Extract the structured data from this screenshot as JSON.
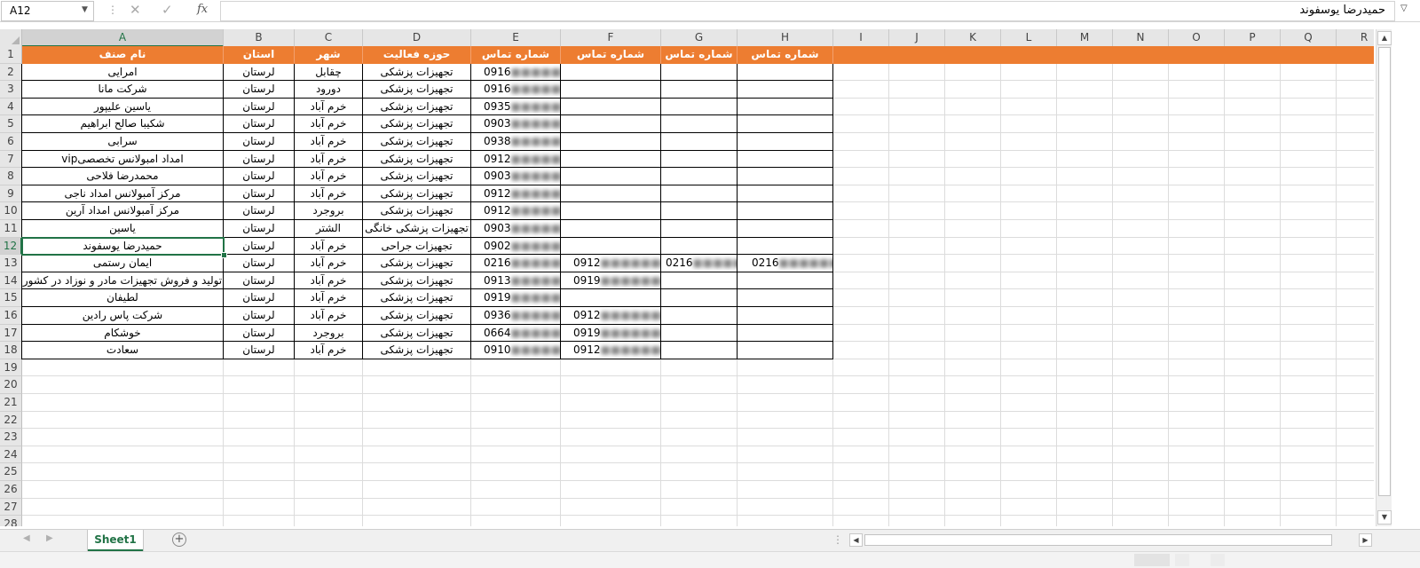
{
  "formula_bar": {
    "name_box": "A12",
    "fx_label": "fx",
    "formula_text": "حمیدرضا یوسفوند"
  },
  "columns": [
    "A",
    "B",
    "C",
    "D",
    "E",
    "F",
    "G",
    "H",
    "I",
    "J",
    "K",
    "L",
    "M",
    "N",
    "O",
    "P",
    "Q",
    "R"
  ],
  "rows": [
    "1",
    "2",
    "3",
    "4",
    "5",
    "6",
    "7",
    "8",
    "9",
    "10",
    "11",
    "12",
    "13",
    "14",
    "15",
    "16",
    "17",
    "18",
    "19",
    "20",
    "21",
    "22",
    "23",
    "24",
    "25",
    "26",
    "27",
    "28"
  ],
  "table": {
    "headers": [
      "نام صنف",
      "استان",
      "شهر",
      "حوزه فعالیت",
      "شماره تماس",
      "شماره تماس",
      "شماره تماس",
      "شماره تماس"
    ],
    "data": [
      [
        "امرایی",
        "لرستان",
        "چقابل",
        "تجهیزات پزشکی",
        "0916",
        "",
        "",
        ""
      ],
      [
        "شرکت مانا",
        "لرستان",
        "دورود",
        "تجهیزات پزشکی",
        "0916",
        "",
        "",
        ""
      ],
      [
        "یاسین علیپور",
        "لرستان",
        "خرم آباد",
        "تجهیزات پزشکی",
        "0935",
        "",
        "",
        ""
      ],
      [
        "شکیبا صالح ابراهیم",
        "لرستان",
        "خرم آباد",
        "تجهیزات پزشکی",
        "0903",
        "",
        "",
        ""
      ],
      [
        "سرابی",
        "لرستان",
        "خرم آباد",
        "تجهیزات پزشکی",
        "0938",
        "",
        "",
        ""
      ],
      [
        "امداد امبولانس تخصصیvip",
        "لرستان",
        "خرم آباد",
        "تجهیزات پزشکی",
        "0912",
        "",
        "",
        ""
      ],
      [
        "محمدرضا فلاحی",
        "لرستان",
        "خرم آباد",
        "تجهیزات پزشکی",
        "0903",
        "",
        "",
        ""
      ],
      [
        "مرکز آمبولانس امداد ناجی",
        "لرستان",
        "خرم آباد",
        "تجهیزات پزشکی",
        "0912",
        "",
        "",
        ""
      ],
      [
        "مرکز آمبولانس امداد آرین",
        "لرستان",
        "بروجرد",
        "تجهیزات پزشکی",
        "0912",
        "",
        "",
        ""
      ],
      [
        "یاسین",
        "لرستان",
        "الشتر",
        "تجهیزات پزشکی خانگی",
        "0903",
        "",
        "",
        ""
      ],
      [
        "حمیدرضا یوسفوند",
        "لرستان",
        "خرم آباد",
        "تجهیزات جراحی",
        "0902",
        "",
        "",
        ""
      ],
      [
        "ایمان رستمی",
        "لرستان",
        "خرم آباد",
        "تجهیزات پزشکی",
        "0216",
        "0912",
        "0216",
        "0216"
      ],
      [
        "تولید و فروش تجهیزات مادر و نوزاد در کشور",
        "لرستان",
        "خرم آباد",
        "تجهیزات پزشکی",
        "0913",
        "0919",
        "",
        ""
      ],
      [
        "لطیفان",
        "لرستان",
        "خرم آباد",
        "تجهیزات پزشکی",
        "0919",
        "",
        "",
        ""
      ],
      [
        "شرکت پاس رادین",
        "لرستان",
        "خرم آباد",
        "تجهیزات پزشکی",
        "0936",
        "0912",
        "",
        ""
      ],
      [
        "خوشکام",
        "لرستان",
        "بروجرد",
        "تجهیزات پزشکی",
        "0664",
        "0919",
        "",
        ""
      ],
      [
        "سعادت",
        "لرستان",
        "خرم آباد",
        "تجهیزات پزشکی",
        "0910",
        "0912",
        "",
        ""
      ]
    ]
  },
  "sheet_tabs": [
    "Sheet1"
  ],
  "colors": {
    "header_bg": "#ed7d31",
    "excel_green": "#217346"
  },
  "icons": [
    "cancel-icon",
    "enter-icon",
    "function-icon",
    "add-sheet-icon",
    "scroll-left-icon",
    "scroll-right-icon"
  ]
}
